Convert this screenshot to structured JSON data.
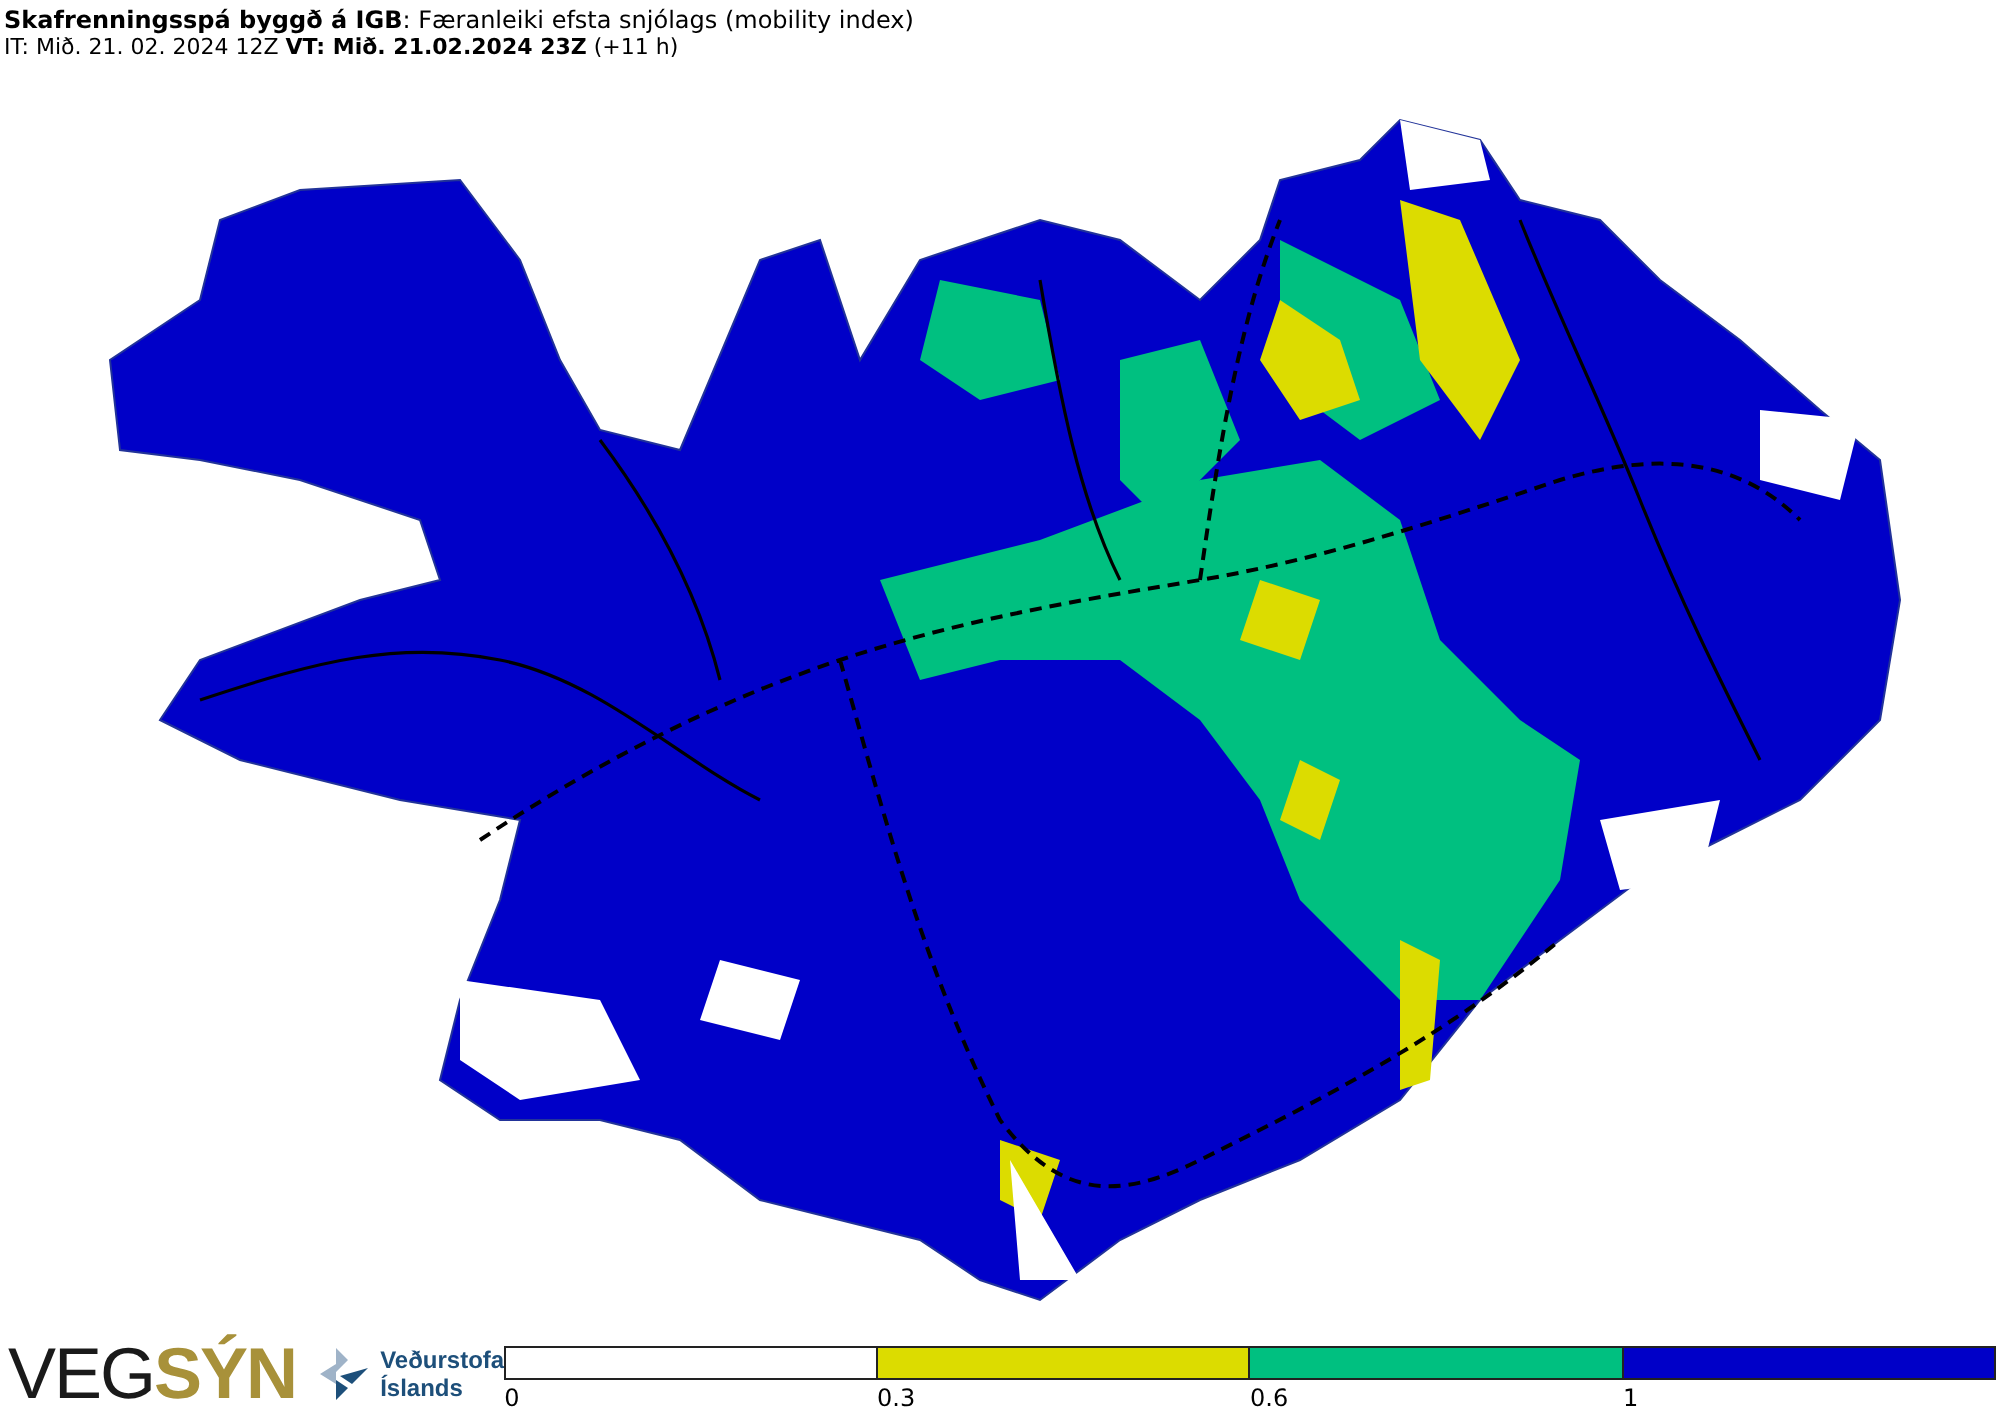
{
  "header": {
    "title": "**Skafrenningsspá byggð á IGB**: Færanleiki efsta snjólags (mobility index)",
    "subtitle": "IT: Mið. 21. 02. 2024 12Z **VT: Mið. 21.02.2024 23Z** (+11 h)"
  },
  "logos": {
    "vegsyn": [
      {
        "text": "VEG",
        "kind": "plain"
      },
      {
        "text": "SÝN",
        "kind": "bold"
      }
    ],
    "vedurstofa": [
      "Veðurstofa",
      "Íslands"
    ]
  },
  "legend": {
    "bins": [
      {
        "color": "#ffffff",
        "label": "0"
      },
      {
        "color": "#dcdc00",
        "label": "0.3"
      },
      {
        "color": "#00c080",
        "label": "0.6"
      },
      {
        "color": "#0000c8",
        "label": "1"
      }
    ]
  }
}
